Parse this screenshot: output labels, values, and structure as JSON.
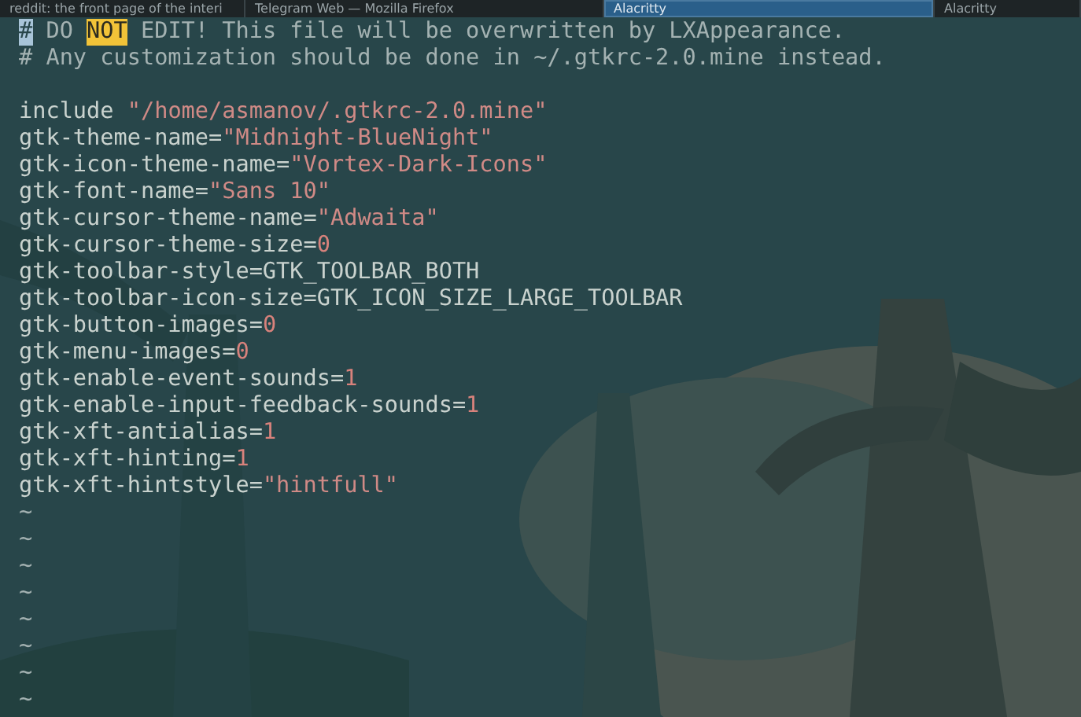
{
  "taskbar": {
    "tasks": [
      {
        "label": "reddit: the front page of the interi",
        "selected": false
      },
      {
        "label": "Telegram Web — Mozilla Firefox",
        "selected": false
      },
      {
        "label": "Alacritty",
        "selected": true
      },
      {
        "label": "Alacritty",
        "selected": false
      }
    ]
  },
  "editor": {
    "lines": [
      {
        "kind": "code",
        "segments": [
          {
            "kind": "cursor",
            "text": "#"
          },
          {
            "kind": "comment",
            "text": " DO "
          },
          {
            "kind": "highlight",
            "text": "NOT"
          },
          {
            "kind": "comment",
            "text": " EDIT! This file will be overwritten by LXAppearance."
          }
        ]
      },
      {
        "kind": "code",
        "segments": [
          {
            "kind": "comment",
            "text": "# Any customization should be done in ~/.gtkrc-2.0.mine instead."
          }
        ]
      },
      {
        "kind": "blank"
      },
      {
        "kind": "code",
        "segments": [
          {
            "kind": "plain",
            "text": "include "
          },
          {
            "kind": "string",
            "text": "\"/home/asmanov/.gtkrc-2.0.mine\""
          }
        ]
      },
      {
        "kind": "code",
        "segments": [
          {
            "kind": "plain",
            "text": "gtk-theme-name="
          },
          {
            "kind": "string",
            "text": "\"Midnight-BlueNight\""
          }
        ]
      },
      {
        "kind": "code",
        "segments": [
          {
            "kind": "plain",
            "text": "gtk-icon-theme-name="
          },
          {
            "kind": "string",
            "text": "\"Vortex-Dark-Icons\""
          }
        ]
      },
      {
        "kind": "code",
        "segments": [
          {
            "kind": "plain",
            "text": "gtk-font-name="
          },
          {
            "kind": "string",
            "text": "\"Sans 10\""
          }
        ]
      },
      {
        "kind": "code",
        "segments": [
          {
            "kind": "plain",
            "text": "gtk-cursor-theme-name="
          },
          {
            "kind": "string",
            "text": "\"Adwaita\""
          }
        ]
      },
      {
        "kind": "code",
        "segments": [
          {
            "kind": "plain",
            "text": "gtk-cursor-theme-size="
          },
          {
            "kind": "number",
            "text": "0"
          }
        ]
      },
      {
        "kind": "code",
        "segments": [
          {
            "kind": "plain",
            "text": "gtk-toolbar-style=GTK_TOOLBAR_BOTH"
          }
        ]
      },
      {
        "kind": "code",
        "segments": [
          {
            "kind": "plain",
            "text": "gtk-toolbar-icon-size=GTK_ICON_SIZE_LARGE_TOOLBAR"
          }
        ]
      },
      {
        "kind": "code",
        "segments": [
          {
            "kind": "plain",
            "text": "gtk-button-images="
          },
          {
            "kind": "number",
            "text": "0"
          }
        ]
      },
      {
        "kind": "code",
        "segments": [
          {
            "kind": "plain",
            "text": "gtk-menu-images="
          },
          {
            "kind": "number",
            "text": "0"
          }
        ]
      },
      {
        "kind": "code",
        "segments": [
          {
            "kind": "plain",
            "text": "gtk-enable-event-sounds="
          },
          {
            "kind": "number",
            "text": "1"
          }
        ]
      },
      {
        "kind": "code",
        "segments": [
          {
            "kind": "plain",
            "text": "gtk-enable-input-feedback-sounds="
          },
          {
            "kind": "number",
            "text": "1"
          }
        ]
      },
      {
        "kind": "code",
        "segments": [
          {
            "kind": "plain",
            "text": "gtk-xft-antialias="
          },
          {
            "kind": "number",
            "text": "1"
          }
        ]
      },
      {
        "kind": "code",
        "segments": [
          {
            "kind": "plain",
            "text": "gtk-xft-hinting="
          },
          {
            "kind": "number",
            "text": "1"
          }
        ]
      },
      {
        "kind": "code",
        "segments": [
          {
            "kind": "plain",
            "text": "gtk-xft-hintstyle="
          },
          {
            "kind": "string",
            "text": "\"hintfull\""
          }
        ]
      },
      {
        "kind": "filler",
        "text": "~"
      },
      {
        "kind": "filler",
        "text": "~"
      },
      {
        "kind": "filler",
        "text": "~"
      },
      {
        "kind": "filler",
        "text": "~"
      },
      {
        "kind": "filler",
        "text": "~"
      },
      {
        "kind": "filler",
        "text": "~"
      },
      {
        "kind": "filler",
        "text": "~"
      },
      {
        "kind": "filler",
        "text": "~"
      }
    ]
  }
}
